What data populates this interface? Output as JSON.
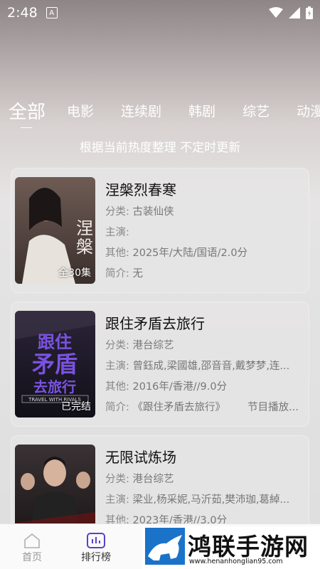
{
  "status_bar": {
    "time": "2:48",
    "notif_glyph": "A"
  },
  "tabs": [
    "全部",
    "电影",
    "连续剧",
    "韩剧",
    "综艺",
    "动漫"
  ],
  "subtitle": "根据当前热度整理 不定时更新",
  "labels": {
    "category": "分类:",
    "cast": "主演:",
    "other": "其他:",
    "intro": "简介:"
  },
  "cards": [
    {
      "title": "涅槃烈春寒",
      "category": "古装仙侠",
      "cast": "",
      "other": "2025年/大陆/国语/2.0分",
      "intro": "无",
      "intro_extra": "",
      "badge": "全30集",
      "poster_text": "涅槃烈春寒",
      "poster_colors": [
        "#6e5b54",
        "#3b302d"
      ]
    },
    {
      "title": "跟住矛盾去旅行",
      "category": "港台综艺",
      "cast": "曾鈺成,梁國雄,邵音音,戴梦梦,连...",
      "other": "2016年/香港//9.0分",
      "intro": "《跟住矛盾去旅行》",
      "intro_extra": "节目播放...",
      "badge": "已完结",
      "poster_text": "跟住矛盾去旅行",
      "poster_sub": "TRAVEL WITH RIVALS",
      "poster_colors": [
        "#2b2438",
        "#111018"
      ]
    },
    {
      "title": "无限试炼场",
      "category": "港台综艺",
      "cast": "梁业,杨采妮,马沂茹,樊沛珈,葛綽...",
      "other": "2023年/香港//3.0分",
      "intro": "",
      "intro_extra": "",
      "badge": "",
      "poster_text": "",
      "poster_colors": [
        "#3a3234",
        "#161213"
      ]
    }
  ],
  "bottom_nav": {
    "home": "首页",
    "ranking": "排行榜"
  },
  "watermark": {
    "text": "鸿联手游网",
    "url": "www.henanhonglian95.com"
  },
  "colors": {
    "accent": "#5b3fd0",
    "nav_inactive": "#999999"
  }
}
